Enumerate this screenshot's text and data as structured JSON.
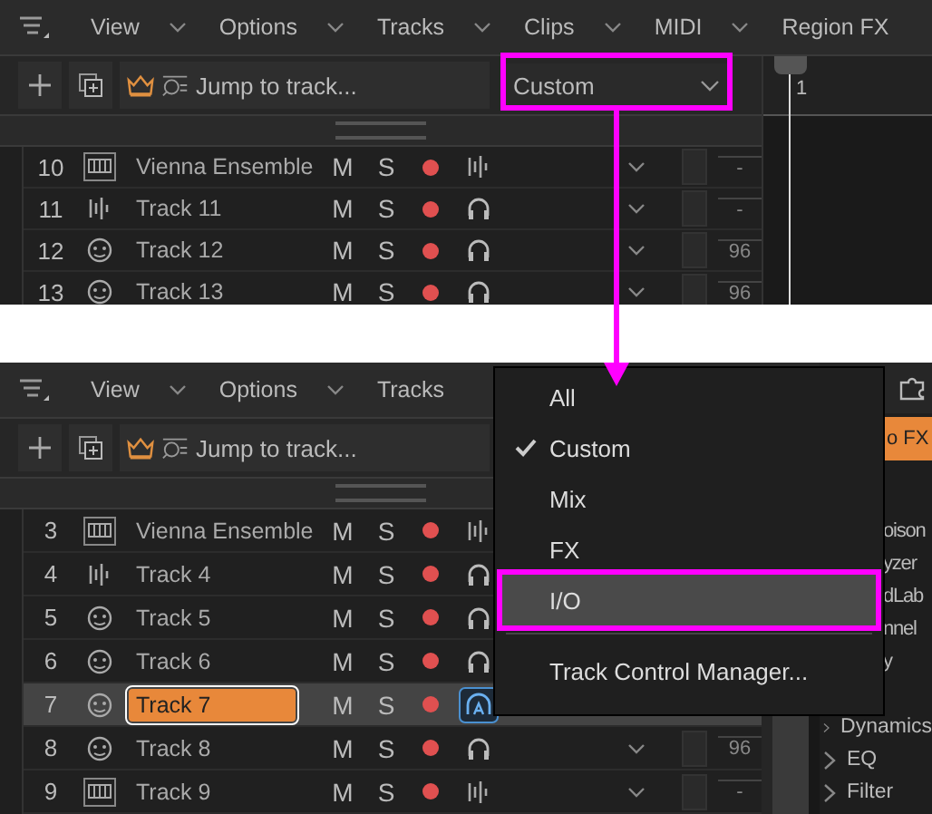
{
  "top": {
    "menubar": [
      {
        "label": "View",
        "chevron": true
      },
      {
        "label": "Options",
        "chevron": true
      },
      {
        "label": "Tracks",
        "chevron": true
      },
      {
        "label": "Clips",
        "chevron": true
      },
      {
        "label": "MIDI",
        "chevron": true
      },
      {
        "label": "Region FX",
        "chevron": false
      }
    ],
    "search": {
      "placeholder": "Jump to track..."
    },
    "preset": {
      "value": "Custom"
    },
    "ruler": {
      "label": "1"
    },
    "tracks": [
      {
        "number": "10",
        "name": "Vienna Ensemble",
        "kind": "instrument",
        "mute": "M",
        "solo": "S",
        "monitor": {
          "kind": "wave"
        },
        "selected": false,
        "reading": "-"
      },
      {
        "number": "11",
        "name": "Track 11",
        "kind": "audio",
        "mute": "M",
        "solo": "S",
        "monitor": {
          "kind": "headphones"
        },
        "selected": false,
        "reading": "-"
      },
      {
        "number": "12",
        "name": "Track 12",
        "kind": "sampler",
        "mute": "M",
        "solo": "S",
        "monitor": {
          "kind": "headphones"
        },
        "selected": false,
        "reading": "96"
      },
      {
        "number": "13",
        "name": "Track 13",
        "kind": "sampler",
        "mute": "M",
        "solo": "S",
        "monitor": {
          "kind": "headphones"
        },
        "selected": false,
        "reading": "96"
      }
    ]
  },
  "bottom": {
    "menubar": [
      {
        "label": "View",
        "chevron": true
      },
      {
        "label": "Options",
        "chevron": true
      },
      {
        "label": "Tracks",
        "chevron": false
      }
    ],
    "search": {
      "placeholder": "Jump to track..."
    },
    "tracks": [
      {
        "number": "3",
        "name": "Vienna Ensemble",
        "kind": "instrument",
        "mute": "M",
        "solo": "S",
        "monitor": {
          "kind": "wave"
        },
        "selected": false
      },
      {
        "number": "4",
        "name": "Track 4",
        "kind": "audio",
        "mute": "M",
        "solo": "S",
        "monitor": {
          "kind": "headphones"
        },
        "selected": false
      },
      {
        "number": "5",
        "name": "Track 5",
        "kind": "sampler",
        "mute": "M",
        "solo": "S",
        "monitor": {
          "kind": "headphones"
        },
        "selected": false
      },
      {
        "number": "6",
        "name": "Track 6",
        "kind": "sampler",
        "mute": "M",
        "solo": "S",
        "monitor": {
          "kind": "headphones"
        },
        "selected": false
      },
      {
        "number": "7",
        "name": "Track 7",
        "kind": "sampler",
        "mute": "M",
        "solo": "S",
        "monitor": {
          "kind": "auto"
        },
        "selected": true
      },
      {
        "number": "8",
        "name": "Track 8",
        "kind": "sampler",
        "mute": "M",
        "solo": "S",
        "monitor": {
          "kind": "headphones"
        },
        "selected": false,
        "reading": "96"
      },
      {
        "number": "9",
        "name": "Track 9",
        "kind": "instrument",
        "mute": "M",
        "solo": "S",
        "monitor": {
          "kind": "wave"
        },
        "selected": false,
        "reading": "-"
      }
    ],
    "browser": {
      "button": "o FX",
      "items": [
        {
          "label": "oison",
          "kind": "partial"
        },
        {
          "label": "yzer",
          "kind": "partial"
        },
        {
          "label": "dLab",
          "kind": "partial"
        },
        {
          "label": "nnel",
          "kind": "partial"
        },
        {
          "label": "y",
          "kind": "partial"
        },
        {
          "label": "Dynamics",
          "kind": "folder"
        },
        {
          "label": "EQ",
          "kind": "folder"
        },
        {
          "label": "Filter",
          "kind": "folder"
        }
      ]
    },
    "menu": {
      "items": [
        {
          "label": "All",
          "checked": false,
          "selected": false
        },
        {
          "label": "Custom",
          "checked": true,
          "selected": false
        },
        {
          "label": "Mix",
          "checked": false,
          "selected": false
        },
        {
          "label": "FX",
          "checked": false,
          "selected": false
        },
        {
          "label": "I/O",
          "checked": false,
          "selected": true
        }
      ],
      "footer": "Track Control Manager..."
    }
  }
}
